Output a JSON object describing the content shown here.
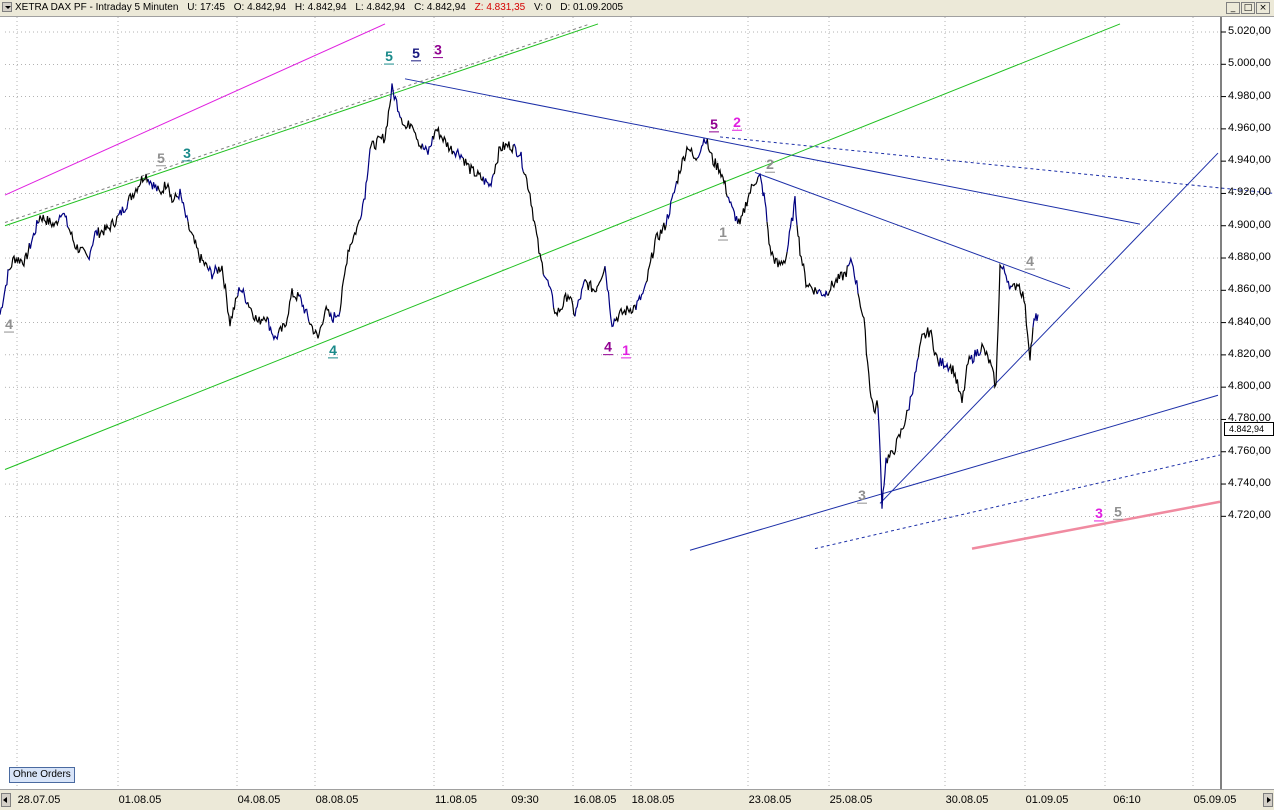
{
  "header": {
    "title": "XETRA DAX PF - Intraday 5 Minuten",
    "time": "U: 17:45",
    "open": "O: 4.842,94",
    "high": "H: 4.842,94",
    "low": "L: 4.842,94",
    "close": "C: 4.842,94",
    "z": "Z: 4.831,35",
    "volume": "V: 0",
    "date": "D: 01.09.2005",
    "buttons": [
      "_",
      "□",
      "×"
    ]
  },
  "last_price": "4.842,94",
  "orders_button": "Ohne Orders",
  "colors": {
    "price_line": "#000000",
    "price_line_recent": "#000080",
    "trend_blue": "#1c2fa8",
    "channel_green": "#20c020",
    "channel_magenta": "#e020e0",
    "line_pink": "#f08aa0",
    "label_teal": "#1a8a8a",
    "label_navy": "#1a1a80",
    "label_purple": "#900090",
    "label_magenta": "#e020e0",
    "label_gray": "#909090",
    "z_value": "#d40000"
  },
  "chart_data": {
    "type": "line",
    "title": "XETRA DAX PF - Intraday 5 Minuten",
    "x_tick_labels": [
      "28.07.05",
      "01.08.05",
      "04.08.05",
      "08.08.05",
      "11.08.05",
      "09:30",
      "16.08.05",
      "18.08.05",
      "23.08.05",
      "25.08.05",
      "30.08.05",
      "01.09.05",
      "06:10",
      "05.09.05"
    ],
    "y_tick_labels": [
      "5.020,00",
      "5.000,00",
      "4.980,00",
      "4.960,00",
      "4.940,00",
      "4.920,00",
      "4.900,00",
      "4.880,00",
      "4.860,00",
      "4.840,00",
      "4.820,00",
      "4.800,00",
      "4.780,00",
      "4.760,00",
      "4.740,00",
      "4.720,00"
    ],
    "y_ticks": [
      5020,
      5000,
      4980,
      4960,
      4940,
      4920,
      4900,
      4880,
      4860,
      4840,
      4820,
      4800,
      4780,
      4760,
      4740,
      4720
    ],
    "ylim": [
      4700,
      5027
    ],
    "xlim_bars": [
      0,
      1230
    ],
    "grid": true,
    "price_series": {
      "name": "XETRA DAX PF",
      "bar_index": [
        0,
        8,
        14,
        25,
        40,
        55,
        62,
        75,
        88,
        95,
        108,
        118,
        128,
        145,
        160,
        168,
        172,
        180,
        188,
        200,
        212,
        222,
        230,
        240,
        250,
        258,
        265,
        275,
        285,
        292,
        300,
        310,
        318,
        325,
        332,
        340,
        348,
        358,
        365,
        370,
        378,
        385,
        392,
        400,
        406,
        412,
        420,
        428,
        436,
        442,
        450,
        460,
        470,
        480,
        490,
        500,
        510,
        520,
        530,
        540,
        550,
        556,
        562,
        568,
        575,
        585,
        595,
        605,
        612,
        620,
        628,
        636,
        645,
        655,
        665,
        672,
        680,
        688,
        695,
        705,
        713,
        720,
        725,
        732,
        740,
        748,
        755,
        760,
        765,
        770,
        778,
        786,
        795,
        800,
        806,
        815,
        825,
        835,
        845,
        852,
        858,
        864,
        870,
        874,
        878,
        882,
        886,
        892,
        900,
        908,
        916,
        922,
        930,
        938,
        946,
        954,
        962,
        968,
        975,
        982,
        990,
        996,
        1000,
        1006,
        1012,
        1018,
        1024,
        1030,
        1034,
        1038
      ],
      "price": [
        4845,
        4870,
        4880,
        4878,
        4906,
        4900,
        4910,
        4888,
        4880,
        4895,
        4898,
        4905,
        4915,
        4932,
        4920,
        4928,
        4915,
        4920,
        4900,
        4880,
        4870,
        4875,
        4840,
        4862,
        4850,
        4840,
        4845,
        4830,
        4838,
        4858,
        4855,
        4840,
        4830,
        4848,
        4842,
        4848,
        4885,
        4900,
        4920,
        4948,
        4952,
        4955,
        4985,
        4970,
        4960,
        4965,
        4950,
        4945,
        4960,
        4955,
        4948,
        4945,
        4935,
        4930,
        4925,
        4948,
        4950,
        4945,
        4920,
        4880,
        4860,
        4845,
        4850,
        4858,
        4845,
        4865,
        4860,
        4875,
        4840,
        4845,
        4848,
        4850,
        4860,
        4890,
        4900,
        4915,
        4935,
        4950,
        4940,
        4955,
        4940,
        4935,
        4925,
        4910,
        4900,
        4918,
        4928,
        4930,
        4915,
        4885,
        4875,
        4880,
        4915,
        4885,
        4865,
        4860,
        4858,
        4865,
        4870,
        4878,
        4860,
        4840,
        4800,
        4785,
        4790,
        4728,
        4755,
        4758,
        4770,
        4785,
        4810,
        4830,
        4835,
        4815,
        4815,
        4810,
        4790,
        4815,
        4820,
        4825,
        4815,
        4800,
        4875,
        4870,
        4860,
        4865,
        4855,
        4820,
        4840,
        4845
      ]
    },
    "trendlines": [
      {
        "kind": "solid",
        "color": "blue",
        "from": [
          405,
          4991
        ],
        "to": [
          1140,
          4901
        ]
      },
      {
        "kind": "dashed",
        "color": "blue",
        "from": [
          720,
          4955
        ],
        "to": [
          1274,
          4920
        ]
      },
      {
        "kind": "solid",
        "color": "blue",
        "from": [
          755,
          4933
        ],
        "to": [
          1070,
          4861
        ]
      },
      {
        "kind": "solid",
        "color": "blue",
        "from": [
          880,
          4728
        ],
        "to": [
          1218,
          4945
        ]
      },
      {
        "kind": "solid",
        "color": "blue",
        "from": [
          690,
          4699
        ],
        "to": [
          1218,
          4795
        ]
      },
      {
        "kind": "dashed",
        "color": "blue",
        "from": [
          815,
          4700
        ],
        "to": [
          1220,
          4758
        ]
      },
      {
        "kind": "solid",
        "color": "green",
        "from": [
          5,
          4749
        ],
        "to": [
          1120,
          5025
        ]
      },
      {
        "kind": "solid",
        "color": "green",
        "from": [
          5,
          4900
        ],
        "to": [
          598,
          5025
        ]
      },
      {
        "kind": "dashed",
        "color": "gray",
        "from": [
          5,
          4902
        ],
        "to": [
          590,
          5025
        ]
      },
      {
        "kind": "solid",
        "color": "magenta",
        "from": [
          5,
          4919
        ],
        "to": [
          385,
          5025
        ]
      },
      {
        "kind": "solid",
        "color": "pink",
        "from": [
          972,
          4700
        ],
        "to": [
          1220,
          4729
        ]
      }
    ],
    "wave_labels": [
      {
        "text": "5",
        "color": "teal",
        "x": 389,
        "y": 5002
      },
      {
        "text": "5",
        "color": "navy",
        "x": 416,
        "y": 5004
      },
      {
        "text": "3",
        "color": "purple",
        "x": 438,
        "y": 5006
      },
      {
        "text": "5",
        "color": "gray",
        "x": 161,
        "y": 4939
      },
      {
        "text": "3",
        "color": "teal",
        "x": 187,
        "y": 4942
      },
      {
        "text": "4",
        "color": "teal",
        "x": 333,
        "y": 4820
      },
      {
        "text": "5",
        "color": "purple",
        "x": 714,
        "y": 4960
      },
      {
        "text": "2",
        "color": "magenta",
        "x": 737,
        "y": 4961
      },
      {
        "text": "2",
        "color": "gray",
        "x": 770,
        "y": 4935
      },
      {
        "text": "1",
        "color": "gray",
        "x": 723,
        "y": 4893
      },
      {
        "text": "4",
        "color": "purple",
        "x": 608,
        "y": 4822
      },
      {
        "text": "1",
        "color": "magenta",
        "x": 626,
        "y": 4820
      },
      {
        "text": "4",
        "color": "gray",
        "x": 1030,
        "y": 4875
      },
      {
        "text": "3",
        "color": "gray",
        "x": 862,
        "y": 4730
      },
      {
        "text": "3",
        "color": "magenta",
        "x": 1099,
        "y": 4719
      },
      {
        "text": "5",
        "color": "gray",
        "x": 1118,
        "y": 4720
      },
      {
        "text": "4",
        "color": "gray",
        "x": 9,
        "y": 4836
      }
    ]
  }
}
